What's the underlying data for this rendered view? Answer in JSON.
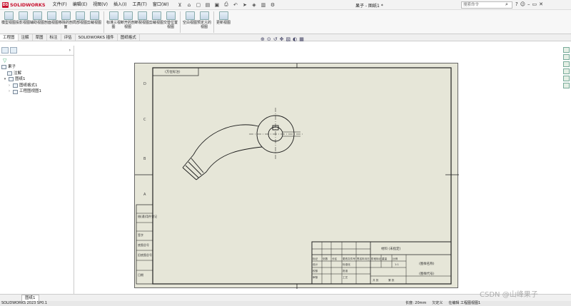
{
  "app": {
    "brand": "SOLIDWORKS",
    "window_title": "果子 - 图纸1 *",
    "search_placeholder": "搜索命令"
  },
  "menu": [
    "文件(F)",
    "编辑(E)",
    "视图(V)",
    "插入(I)",
    "工具(T)",
    "窗口(W)"
  ],
  "ribbon": [
    "模型视图",
    "投影视图",
    "辅助视图",
    "剖面视图",
    "移除的剖面",
    "局部视图",
    "剪裁视图",
    "标准三视图",
    "断开的剖视图",
    "断裂视图",
    "剪裁视图",
    "交替位置视图",
    "空白视图",
    "预定义的视图",
    "更新视图"
  ],
  "tabs": [
    "工程图",
    "注解",
    "草图",
    "标注",
    "评估",
    "SOLIDWORKS 插件",
    "图纸格式"
  ],
  "tree": {
    "root": "果子",
    "annotations": "注解",
    "sheet": "图纸1",
    "sheet_format": "图纸格式1",
    "drawing_view": "工程图视图1"
  },
  "drawing": {
    "top_left_box": "(方位标注)",
    "zone_letters": [
      "A",
      "B",
      "C",
      "D"
    ],
    "left_table": [
      "借(通)用件登记",
      "底图总号",
      "旧底图总号",
      "签字",
      "日期"
    ],
    "title_block": {
      "material": "材料 (未指定)",
      "name": "(图样名称)",
      "code": "(图样代号)",
      "row_labels": [
        "标记",
        "处数",
        "分区",
        "更改文件号",
        "签名",
        "年月日"
      ],
      "people": [
        "设计",
        "校核",
        "审核",
        "工艺",
        "标准化",
        "批准"
      ],
      "stage": [
        "阶段标记",
        "重量",
        "比例"
      ],
      "scale": "1:1",
      "footer": [
        "共  张",
        "第  张"
      ]
    }
  },
  "sheet_tab": "图纸1",
  "status": {
    "left": "SOLIDWORKS 2023 SP0.1",
    "length": "长度: 20mm",
    "define": "欠定义",
    "editing": "在编辑 工程图视图1"
  },
  "watermark": "CSDN @山峰果子"
}
